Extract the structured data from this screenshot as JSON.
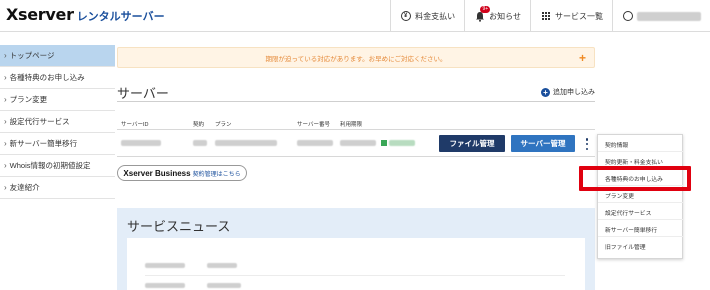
{
  "brand": {
    "logo": "Xserver",
    "subtitle": "レンタルサーバー"
  },
  "header_nav": [
    {
      "label": "料金支払い",
      "icon": "coin-yen-icon"
    },
    {
      "label": "お知らせ",
      "icon": "bell-icon",
      "badge": "9+"
    },
    {
      "label": "サービス一覧",
      "icon": "grid-icon"
    },
    {
      "label": "",
      "icon": "user-icon",
      "user_name_hidden": true
    }
  ],
  "sidebar": {
    "items": [
      {
        "label": "トップページ",
        "active": true
      },
      {
        "label": "各種特典のお申し込み"
      },
      {
        "label": "プラン変更"
      },
      {
        "label": "設定代行サービス"
      },
      {
        "label": "新サーバー簡単移行"
      },
      {
        "label": "Whois情報の初期値設定"
      },
      {
        "label": "友達紹介"
      }
    ]
  },
  "notice": {
    "text": "期限が迫っている対応があります。お早めにご対応ください。",
    "plus": "+"
  },
  "server": {
    "title": "サーバー",
    "add_link": "追加申し込み",
    "columns": [
      "サーバーID",
      "契約",
      "プラン",
      "サーバー番号",
      "利用期限"
    ],
    "file_button": "ファイル管理",
    "server_button": "サーバー管理"
  },
  "business": {
    "brand": "Xserver Business",
    "link": "契約管理はこちら"
  },
  "news": {
    "title": "サービスニュース"
  },
  "dropdown": {
    "items": [
      "契約情報",
      "契約更新・料金支払い",
      "各種特典のお申し込み",
      "プラン変更",
      "設定代行サービス",
      "新サーバー簡単移行",
      "旧ファイル管理"
    ],
    "highlighted_index": 2
  },
  "colors": {
    "accent": "#1a4f9c",
    "dark_button": "#1f3a68",
    "blue_button": "#2f74c0",
    "sidebar_active": "#b9d5ee",
    "notice_bg": "#fff4e5",
    "notice_text": "#e58a3a",
    "highlight": "#e0000f",
    "news_bg": "#e3edf8"
  }
}
